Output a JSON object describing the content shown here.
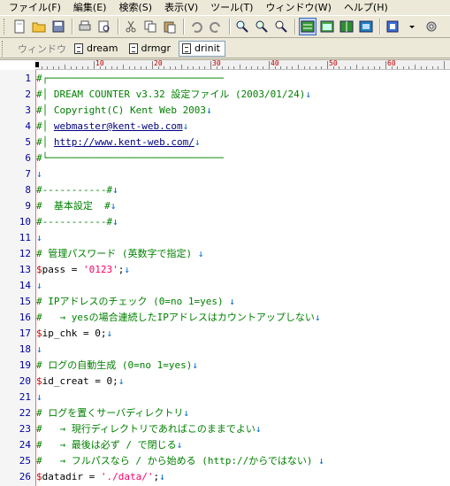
{
  "menu": [
    "ファイル(F)",
    "編集(E)",
    "検索(S)",
    "表示(V)",
    "ツール(T)",
    "ウィンドウ(W)",
    "ヘルプ(H)"
  ],
  "tabbar": {
    "label": "ウィンドウ",
    "tabs": [
      "dream",
      "drmgr",
      "drinit"
    ],
    "active": 2
  },
  "ruler": {
    "marks": [
      "10",
      "20",
      "30",
      "40",
      "50",
      "60"
    ]
  },
  "lines": [
    {
      "n": "1",
      "parts": [
        [
          "c",
          "#┌──────────────────────────────"
        ],
        [
          "eol",
          ""
        ]
      ]
    },
    {
      "n": "2",
      "parts": [
        [
          "c",
          "#│ DREAM COUNTER v3.32 設定ファイル (2003/01/24)"
        ],
        [
          "eol",
          "↓"
        ]
      ]
    },
    {
      "n": "3",
      "parts": [
        [
          "c",
          "#│ Copyright(C) Kent Web 2003"
        ],
        [
          "eol",
          "↓"
        ]
      ]
    },
    {
      "n": "4",
      "parts": [
        [
          "c",
          "#│ "
        ],
        [
          "lnk",
          "webmaster@kent-web.com"
        ],
        [
          "eol",
          "↓"
        ]
      ]
    },
    {
      "n": "5",
      "parts": [
        [
          "c",
          "#│ "
        ],
        [
          "lnk",
          "http://www.kent-web.com/"
        ],
        [
          "eol",
          "↓"
        ]
      ]
    },
    {
      "n": "6",
      "parts": [
        [
          "c",
          "#└──────────────────────────────"
        ],
        [
          "eol",
          ""
        ]
      ]
    },
    {
      "n": "7",
      "parts": [
        [
          "eol",
          "↓"
        ]
      ]
    },
    {
      "n": "8",
      "parts": [
        [
          "c",
          "#-----------#"
        ],
        [
          "eol",
          "↓"
        ]
      ]
    },
    {
      "n": "9",
      "parts": [
        [
          "c",
          "#  基本設定  #"
        ],
        [
          "eol",
          "↓"
        ]
      ]
    },
    {
      "n": "10",
      "parts": [
        [
          "c",
          "#-----------#"
        ],
        [
          "eol",
          "↓"
        ]
      ]
    },
    {
      "n": "11",
      "parts": [
        [
          "eol",
          "↓"
        ]
      ]
    },
    {
      "n": "12",
      "parts": [
        [
          "c",
          "# 管理パスワード (英数字で指定) "
        ],
        [
          "eol",
          "↓"
        ]
      ]
    },
    {
      "n": "13",
      "parts": [
        [
          "d",
          "$"
        ],
        [
          "t",
          "pass = "
        ],
        [
          "s",
          "'0123'"
        ],
        [
          "t",
          ";"
        ],
        [
          "eol",
          "↓"
        ]
      ]
    },
    {
      "n": "14",
      "parts": [
        [
          "eol",
          "↓"
        ]
      ]
    },
    {
      "n": "15",
      "parts": [
        [
          "c",
          "# IPアドレスのチェック (0=no 1=yes) "
        ],
        [
          "eol",
          "↓"
        ]
      ]
    },
    {
      "n": "16",
      "parts": [
        [
          "c",
          "#   → yesの場合連続したIPアドレスはカウントアップしない"
        ],
        [
          "eol",
          "↓"
        ]
      ]
    },
    {
      "n": "17",
      "parts": [
        [
          "d",
          "$"
        ],
        [
          "t",
          "ip_chk = 0;"
        ],
        [
          "eol",
          "↓"
        ]
      ]
    },
    {
      "n": "18",
      "parts": [
        [
          "eol",
          "↓"
        ]
      ]
    },
    {
      "n": "19",
      "parts": [
        [
          "c",
          "# ログの自動生成 (0=no 1=yes)"
        ],
        [
          "eol",
          "↓"
        ]
      ]
    },
    {
      "n": "20",
      "parts": [
        [
          "d",
          "$"
        ],
        [
          "t",
          "id_creat = 0;"
        ],
        [
          "eol",
          "↓"
        ]
      ]
    },
    {
      "n": "21",
      "parts": [
        [
          "eol",
          "↓"
        ]
      ]
    },
    {
      "n": "22",
      "parts": [
        [
          "c",
          "# ログを置くサーバディレクトリ"
        ],
        [
          "eol",
          "↓"
        ]
      ]
    },
    {
      "n": "23",
      "parts": [
        [
          "c",
          "#   → 現行ディレクトリであればこのままでよい"
        ],
        [
          "eol",
          "↓"
        ]
      ]
    },
    {
      "n": "24",
      "parts": [
        [
          "c",
          "#   → 最後は必ず / で閉じる"
        ],
        [
          "eol",
          "↓"
        ]
      ]
    },
    {
      "n": "25",
      "parts": [
        [
          "c",
          "#   → フルパスなら / から始める (http://からではない) "
        ],
        [
          "eol",
          "↓"
        ]
      ]
    },
    {
      "n": "26",
      "parts": [
        [
          "d",
          "$"
        ],
        [
          "t",
          "datadir = "
        ],
        [
          "s",
          "'./data/'"
        ],
        [
          "t",
          ";"
        ],
        [
          "eol",
          "↓"
        ]
      ]
    }
  ]
}
